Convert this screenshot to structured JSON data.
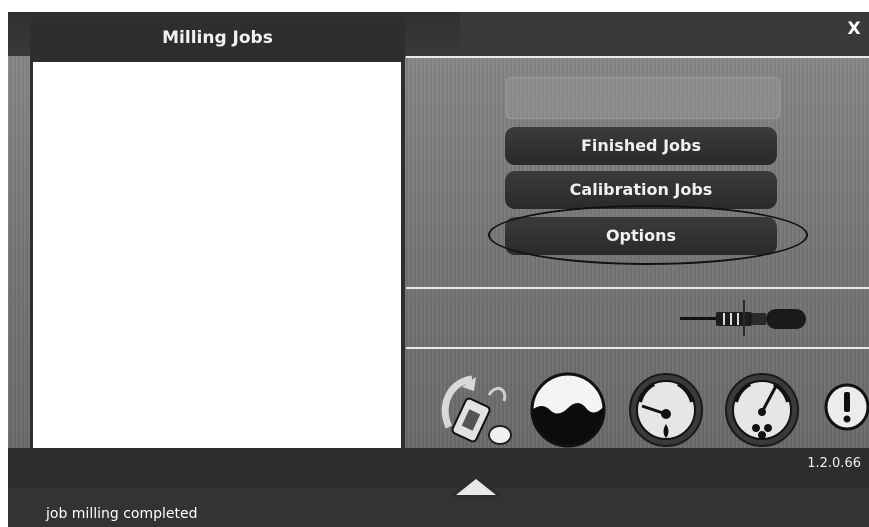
{
  "window": {
    "close_label": "X"
  },
  "jobs_panel": {
    "title": "Milling Jobs",
    "items": []
  },
  "menu": {
    "finished_jobs_label": "Finished Jobs",
    "calibration_jobs_label": "Calibration Jobs",
    "options_label": "Options",
    "highlighted": "Options"
  },
  "footer": {
    "version": "1.2.0.66"
  },
  "status": {
    "message": "job milling completed"
  },
  "icons": {
    "tool": "milling-tool-icon",
    "change_tool": "tool-change-icon",
    "water": "water-tank-icon",
    "pressure": "pressure-gauge-icon",
    "suction": "suction-gauge-icon",
    "warning": "warning-icon",
    "expand": "expand-up-arrow-icon"
  },
  "colors": {
    "background": "#5d5d5d",
    "panel": "#2e2e2e",
    "button": "#2f2f2f",
    "text": "#f0f0f0",
    "highlight_ring": "#111111"
  }
}
